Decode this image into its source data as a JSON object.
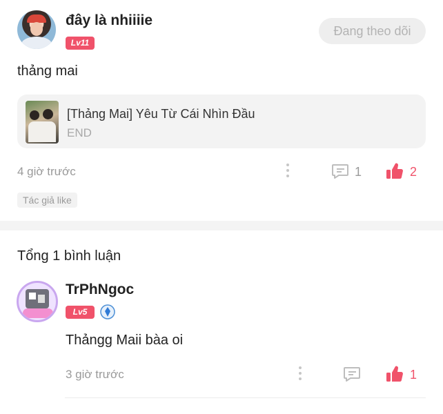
{
  "post": {
    "username": "đây là nhiiiie",
    "level": "Lv11",
    "follow_label": "Đang theo dõi",
    "text": "thảng mai",
    "story": {
      "title": "[Thảng Mai] Yêu Từ Cái Nhìn Đầu",
      "status": "END"
    },
    "time": "4 giờ trước",
    "comment_count": "1",
    "like_count": "2",
    "author_like_tag": "Tác giả like"
  },
  "comments": {
    "title": "Tổng 1 bình luận",
    "items": [
      {
        "username": "TrPhNgoc",
        "level": "Lv5",
        "text": "Thảngg Maii bàa oi",
        "time": "3 giờ trước",
        "like_count": "1"
      }
    ]
  },
  "colors": {
    "accent": "#f0526a",
    "muted": "#9a9a9a",
    "icon_gray": "#c6c6c6",
    "follow_bg": "#eeeeee"
  },
  "icons": {
    "more": "more-vertical-icon",
    "comment": "comment-icon",
    "like": "thumbs-up-icon",
    "badge": "blue-diamond-badge-icon"
  }
}
